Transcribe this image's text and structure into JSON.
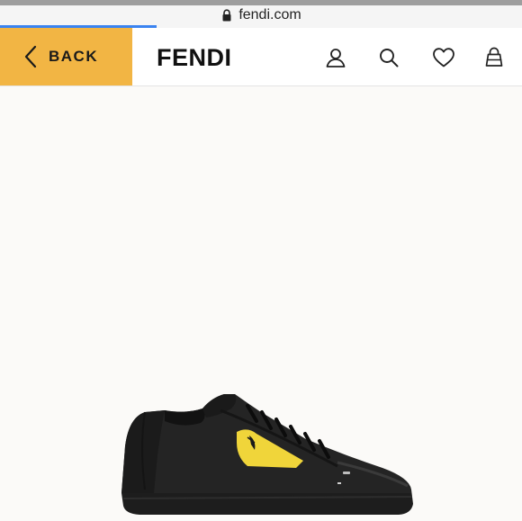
{
  "browser": {
    "url": "fendi.com",
    "progress": 0.3,
    "icons": {
      "lock": "lock-icon"
    }
  },
  "header": {
    "back_label": "BACK",
    "logo": "FENDI",
    "accent_color": "#f2b544",
    "icons": [
      "account-icon",
      "search-icon",
      "wishlist-heart-icon",
      "shopping-bag-icon"
    ]
  },
  "product": {
    "image": "black leather sneaker with yellow monster-eye patch"
  }
}
